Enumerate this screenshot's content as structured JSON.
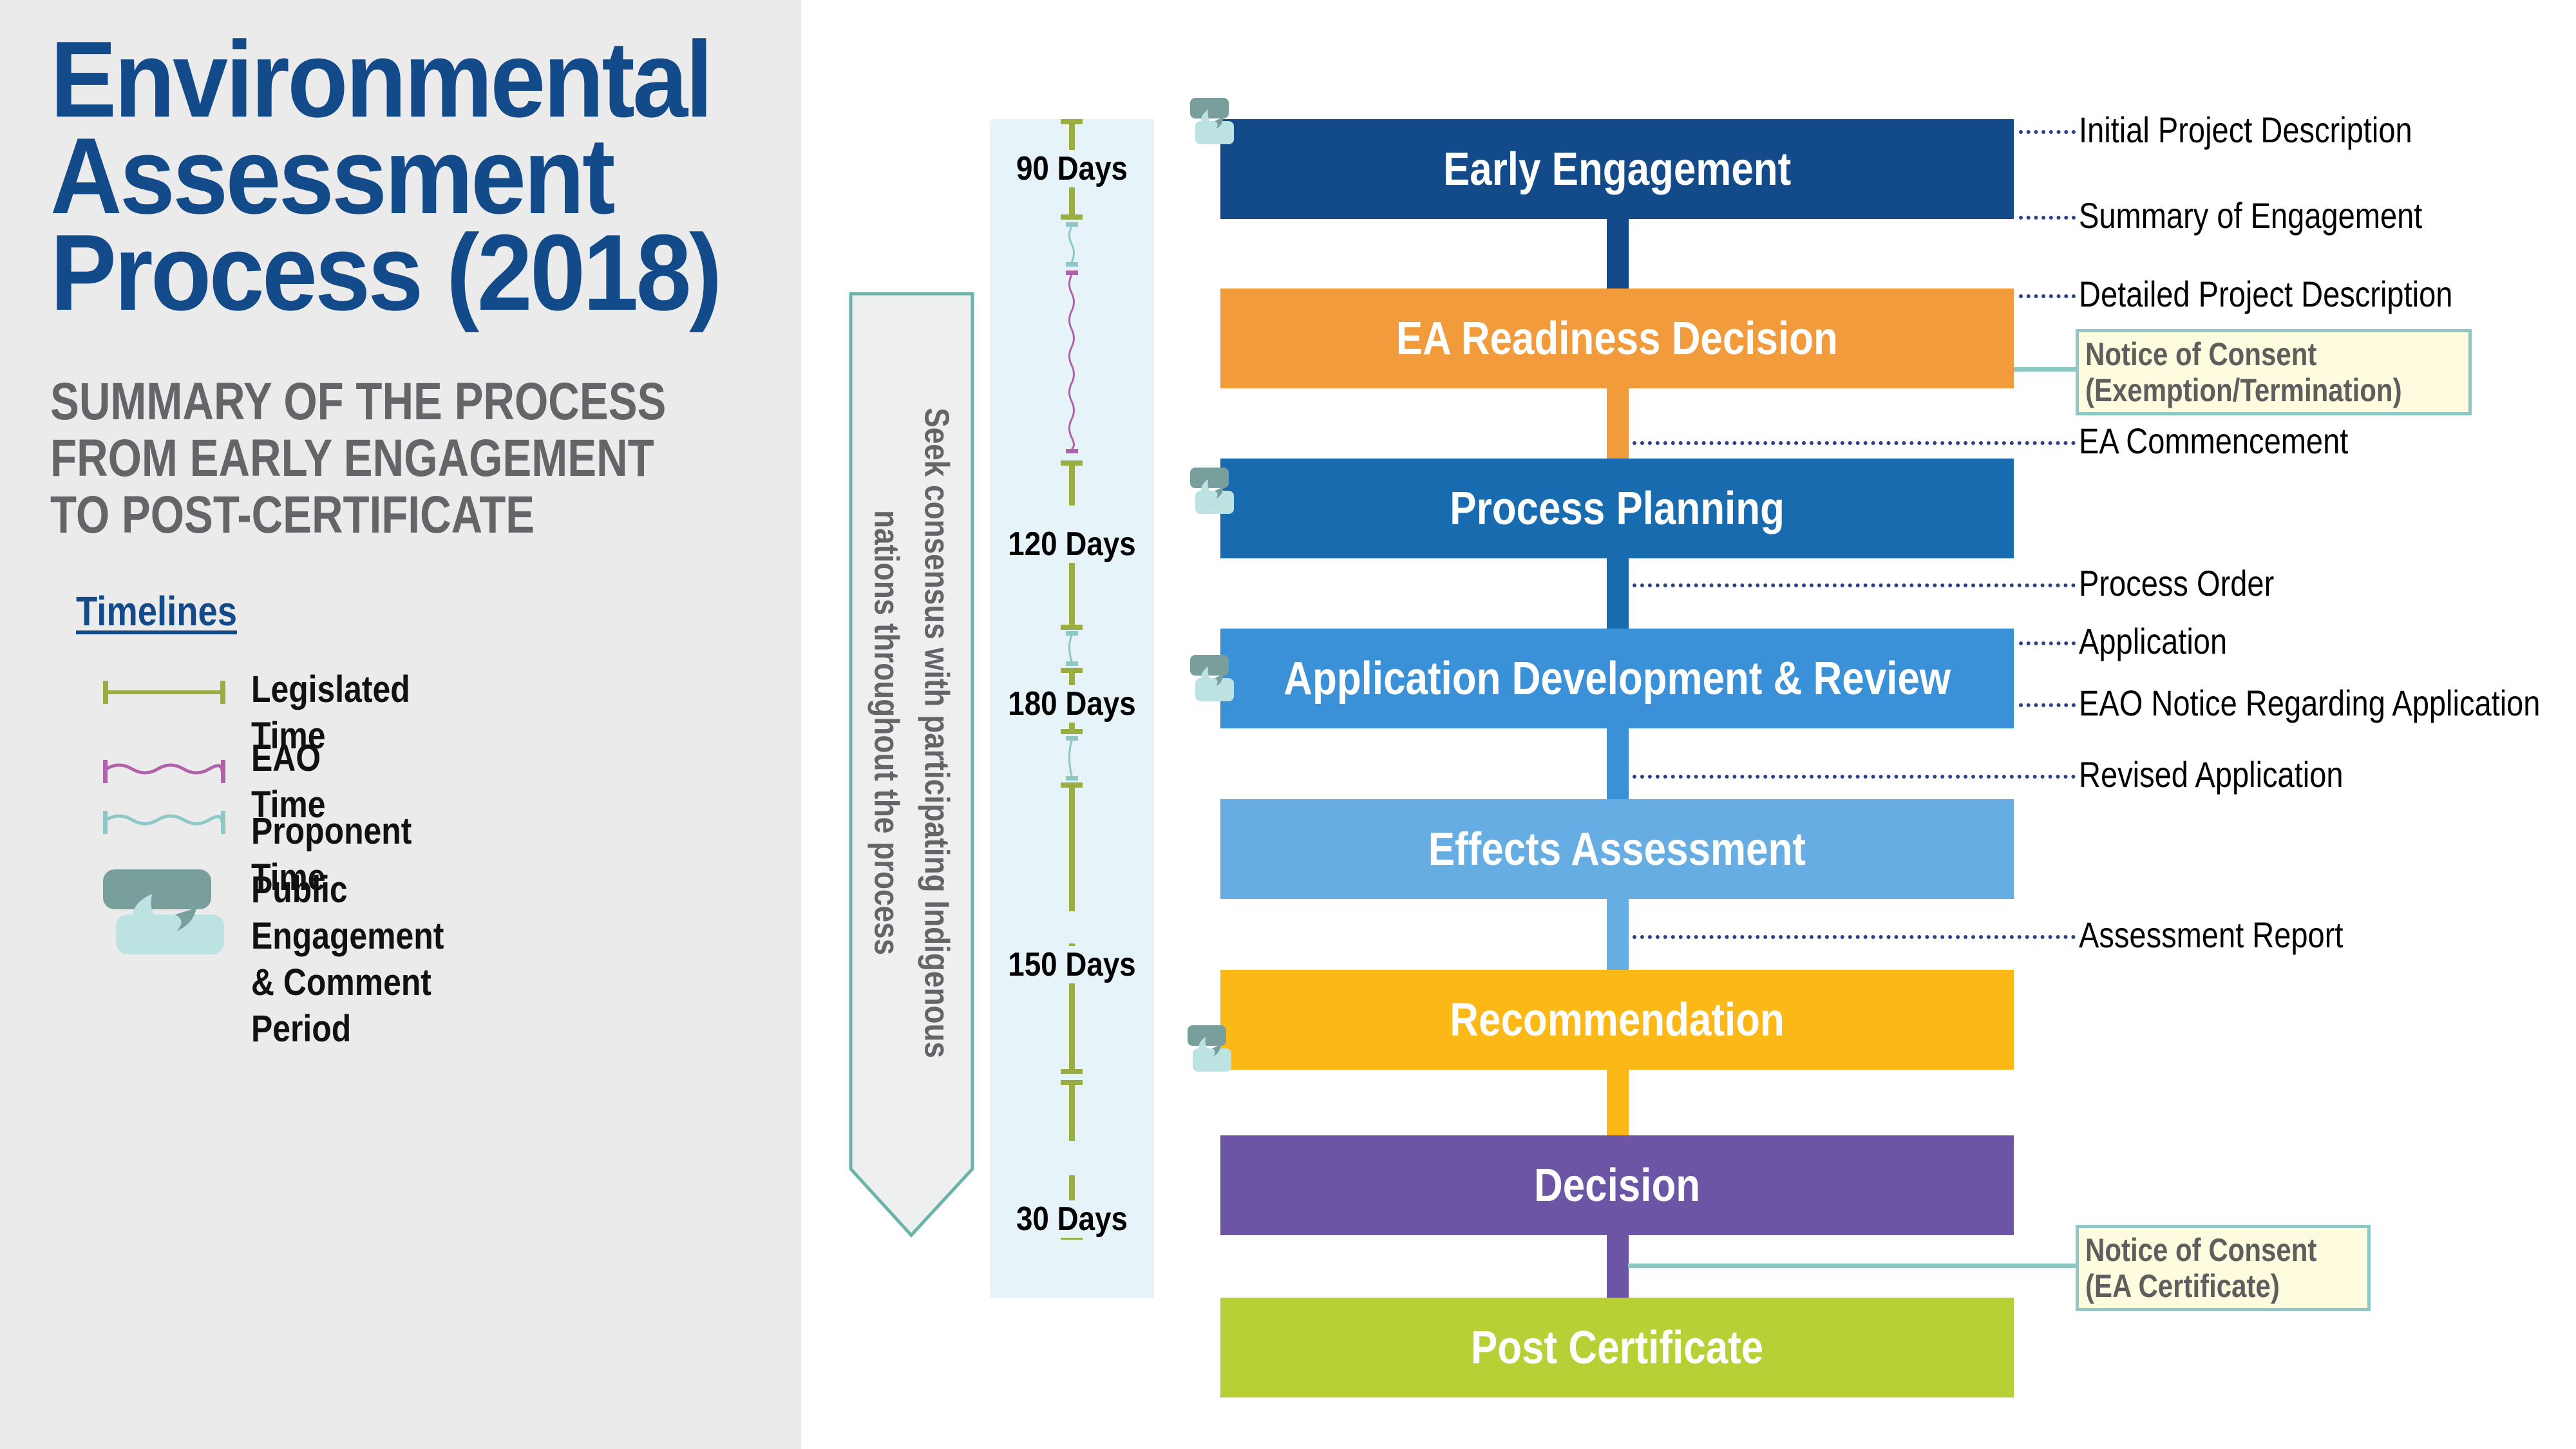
{
  "header": {
    "title": "Environmental\nAssessment\nProcess (2018)",
    "subtitle": "SUMMARY OF THE PROCESS\nFROM EARLY ENGAGEMENT\nTO POST-CERTIFICATE"
  },
  "legend": {
    "heading": "Timelines",
    "items": [
      {
        "label": "Legislated Time",
        "icon": "legislated-time-bar-icon",
        "color": "#9aad42"
      },
      {
        "label": "EAO Time",
        "icon": "eao-time-wave-icon",
        "color": "#b062ab"
      },
      {
        "label": "Proponent Time",
        "icon": "proponent-time-wave-icon",
        "color": "#8ec8c6"
      },
      {
        "label": "Public Engagement\n& Comment Period",
        "icon": "speech-bubbles-icon",
        "color": "#789f9b"
      }
    ]
  },
  "banner": {
    "text": "Seek consensus with participating Indigenous nations throughout the process",
    "border_color": "#6ab3a8"
  },
  "timeline": {
    "durations": [
      {
        "label": "90 Days",
        "type": "legislated"
      },
      {
        "label": "120 Days",
        "type": "legislated"
      },
      {
        "label": "180 Days",
        "type": "legislated"
      },
      {
        "label": "150 Days",
        "type": "legislated"
      },
      {
        "label": "30 Days",
        "type": "legislated"
      }
    ]
  },
  "stages": [
    {
      "label": "Early Engagement",
      "color": "#134a8a",
      "public_engagement": true
    },
    {
      "label": "EA Readiness Decision",
      "color": "#f19b3c",
      "public_engagement": false
    },
    {
      "label": "Process Planning",
      "color": "#196bb0",
      "public_engagement": true
    },
    {
      "label": "Application Development & Review",
      "color": "#3b91d8",
      "public_engagement": true
    },
    {
      "label": "Effects Assessment",
      "color": "#66ade3",
      "public_engagement": false
    },
    {
      "label": "Recommendation",
      "color": "#fbb817",
      "public_engagement": true
    },
    {
      "label": "Decision",
      "color": "#6b55a4",
      "public_engagement": false
    },
    {
      "label": "Post Certificate",
      "color": "#b8cf35",
      "public_engagement": false
    }
  ],
  "outputs": [
    "Initial Project Description",
    "Summary of Engagement",
    "Detailed Project Description",
    "EA Commencement",
    "Process Order",
    "Application",
    "EAO Notice Regarding Application",
    "Revised Application",
    "Assessment Report"
  ],
  "notices": [
    {
      "line1": "Notice of Consent",
      "line2": "(Exemption/Termination)"
    },
    {
      "line1": "Notice of Consent",
      "line2": "(EA Certificate)"
    }
  ]
}
